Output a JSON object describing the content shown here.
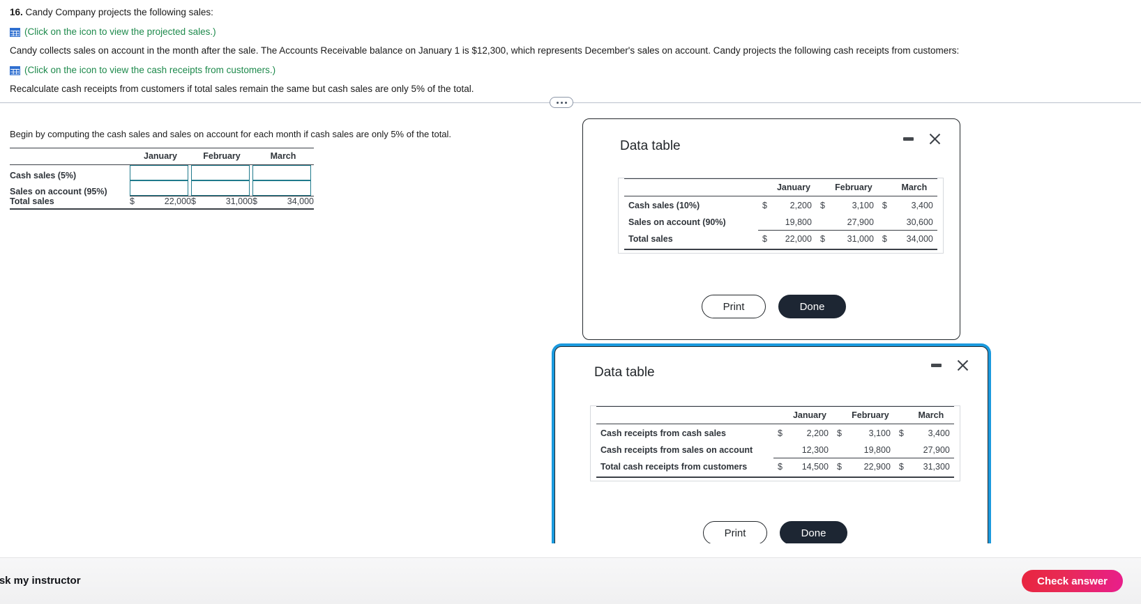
{
  "question": {
    "number": "16.",
    "intro": "Candy Company projects the following sales:",
    "link1": "(Click on the icon to view the projected sales.)",
    "body": "Candy collects sales on account in the month after the sale. The Accounts Receivable balance on January 1 is $12,300, which represents December's sales on account. Candy projects the following cash receipts from customers:",
    "link2": "(Click on the icon to view the cash receipts from customers.)",
    "requirement": "Recalculate cash receipts from customers if total sales remain the same but cash sales are only 5% of the total.",
    "icon1": "table-grid-icon",
    "icon2": "table-grid-icon"
  },
  "worksheet": {
    "instruction": "Begin by computing the cash sales and sales on account for each month if cash sales are only 5% of the total.",
    "columns": [
      "January",
      "February",
      "March"
    ],
    "rows": [
      {
        "label": "Cash sales (5%)",
        "type": "input",
        "values": [
          "",
          "",
          ""
        ],
        "placeholder": ""
      },
      {
        "label": "Sales on account (95%)",
        "type": "input",
        "values": [
          "",
          "",
          ""
        ],
        "placeholder": ""
      }
    ],
    "total_row": {
      "label": "Total sales",
      "currency": "$",
      "values": [
        "22,000",
        "31,000",
        "34,000"
      ]
    }
  },
  "dialog1": {
    "title": "Data table",
    "minimize_icon": "minimize-icon",
    "close_icon": "close-icon",
    "columns": [
      "January",
      "February",
      "March"
    ],
    "rows": [
      {
        "label": "Cash sales (10%)",
        "currency": "$",
        "values": [
          "2,200",
          "3,100",
          "3,400"
        ]
      },
      {
        "label": "Sales on account (90%)",
        "currency": "",
        "values": [
          "19,800",
          "27,900",
          "30,600"
        ]
      }
    ],
    "total_row": {
      "label": "Total sales",
      "currency": "$",
      "values": [
        "22,000",
        "31,000",
        "34,000"
      ]
    },
    "print_label": "Print",
    "done_label": "Done"
  },
  "dialog2": {
    "title": "Data table",
    "minimize_icon": "minimize-icon",
    "close_icon": "close-icon",
    "columns": [
      "January",
      "February",
      "March"
    ],
    "rows": [
      {
        "label": "Cash receipts from cash sales",
        "currency": "$",
        "values": [
          "2,200",
          "3,100",
          "3,400"
        ]
      },
      {
        "label": "Cash receipts from sales on account",
        "currency": "",
        "values": [
          "12,300",
          "19,800",
          "27,900"
        ]
      }
    ],
    "total_row": {
      "label": "Total cash receipts from customers",
      "currency": "$",
      "values": [
        "14,500",
        "22,900",
        "31,300"
      ]
    },
    "print_label": "Print",
    "done_label": "Done"
  },
  "bottom_bar": {
    "ask_instructor": "Ask my instructor",
    "check_answer": "Check answer"
  },
  "colors": {
    "link_green": "#1e8a4c",
    "icon_blue": "#2f6fd0",
    "input_border": "#1f7a8c",
    "focus_blue": "#1b9ade",
    "done_dark": "#1d2633",
    "check_gradient_start": "#e8253f",
    "check_gradient_end": "#e81e8c"
  }
}
